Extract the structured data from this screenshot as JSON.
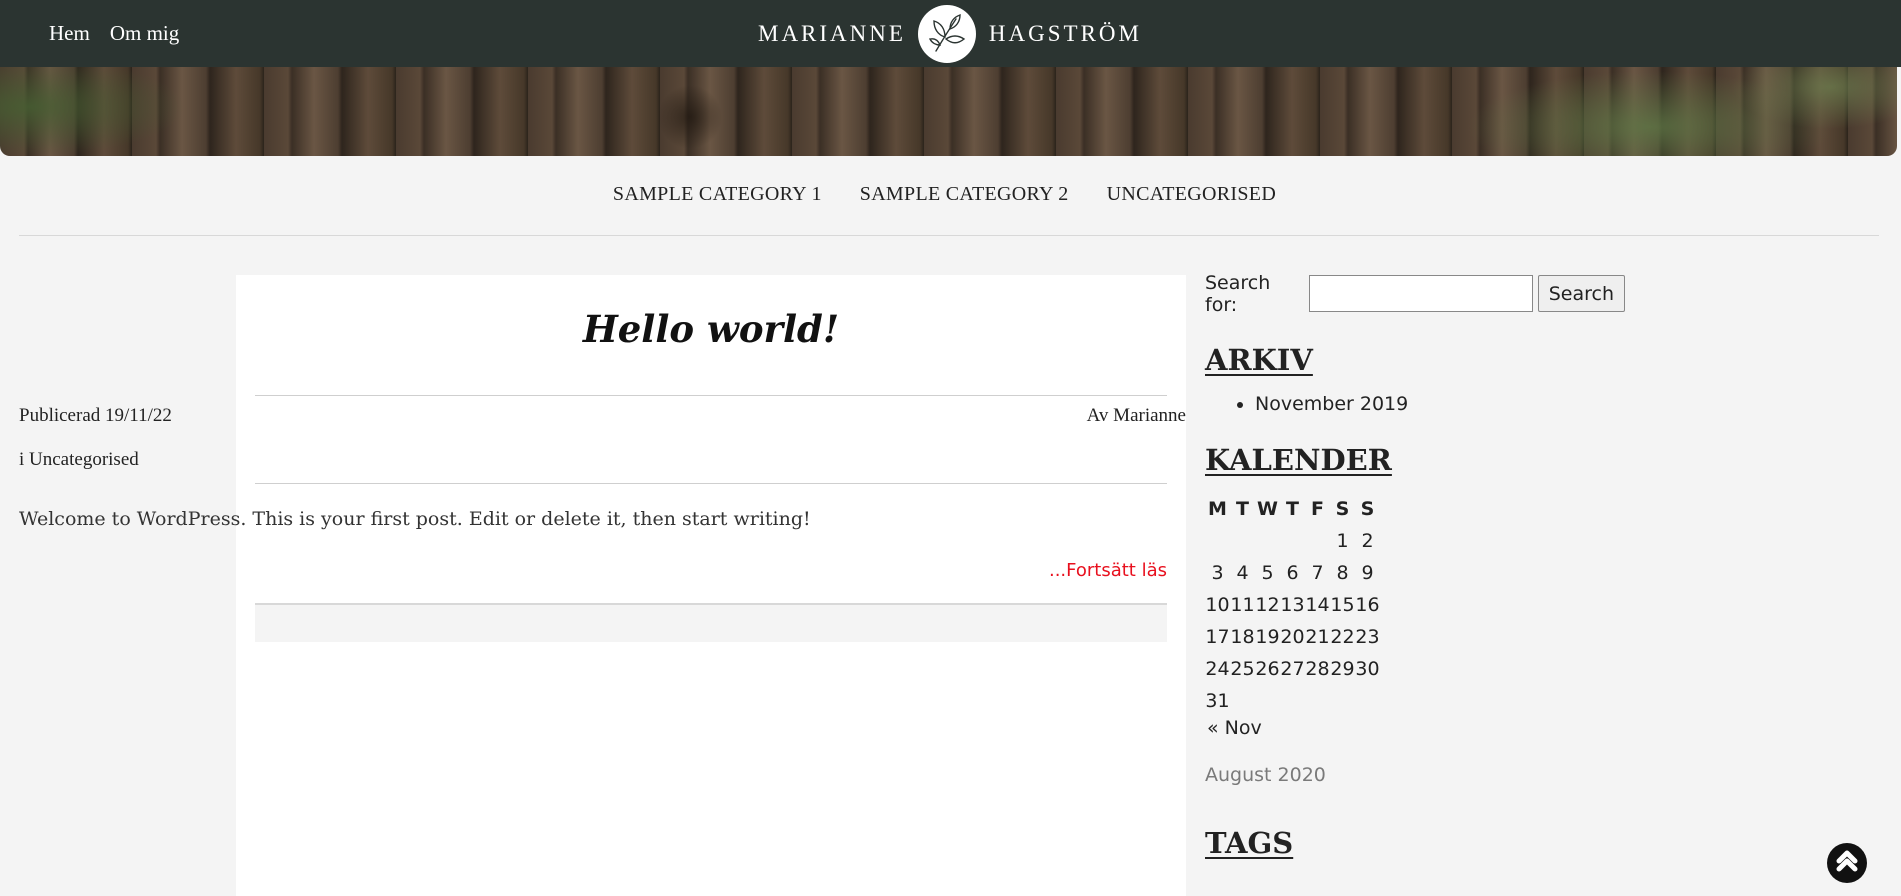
{
  "topnav": {
    "items": [
      {
        "label": "Hem"
      },
      {
        "label": "Om mig"
      }
    ]
  },
  "brand": {
    "first": "MARIANNE",
    "last": "HAGSTRÖM",
    "logo_icon": "leaf-branch-icon"
  },
  "categories": [
    "SAMPLE CATEGORY 1",
    "SAMPLE CATEGORY 2",
    "UNCATEGORISED"
  ],
  "post": {
    "title": "Hello world!",
    "published": "Publicerad 19/11/22",
    "author": "Av Marianne",
    "category": "i Uncategorised",
    "excerpt": "Welcome to WordPress. This is your first post. Edit or delete it, then start writing!",
    "read_more": "...Fortsätt läs"
  },
  "sidebar": {
    "search": {
      "label": "Search for:",
      "placeholder": "",
      "button": "Search"
    },
    "archive": {
      "title": "ARKIV",
      "items": [
        "November 2019"
      ]
    },
    "calendar": {
      "title": "KALENDER",
      "headers": [
        "M",
        "T",
        "W",
        "T",
        "F",
        "S",
        "S"
      ],
      "weeks": [
        [
          "",
          "",
          "",
          "",
          "",
          "1",
          "2"
        ],
        [
          "3",
          "4",
          "5",
          "6",
          "7",
          "8",
          "9"
        ],
        [
          "10",
          "11",
          "12",
          "13",
          "14",
          "15",
          "16"
        ],
        [
          "17",
          "18",
          "19",
          "20",
          "21",
          "22",
          "23"
        ],
        [
          "24",
          "25",
          "26",
          "27",
          "28",
          "29",
          "30"
        ],
        [
          "31",
          "",
          "",
          "",
          "",
          "",
          ""
        ]
      ],
      "prev_link": "« Nov",
      "caption": "August 2020"
    },
    "tags": {
      "title": "TAGS"
    }
  },
  "back_to_top_icon": "chevron-up-icon",
  "colors": {
    "topbar": "#2b3431",
    "background": "#f4f4f4",
    "read_more": "#e8101e"
  }
}
